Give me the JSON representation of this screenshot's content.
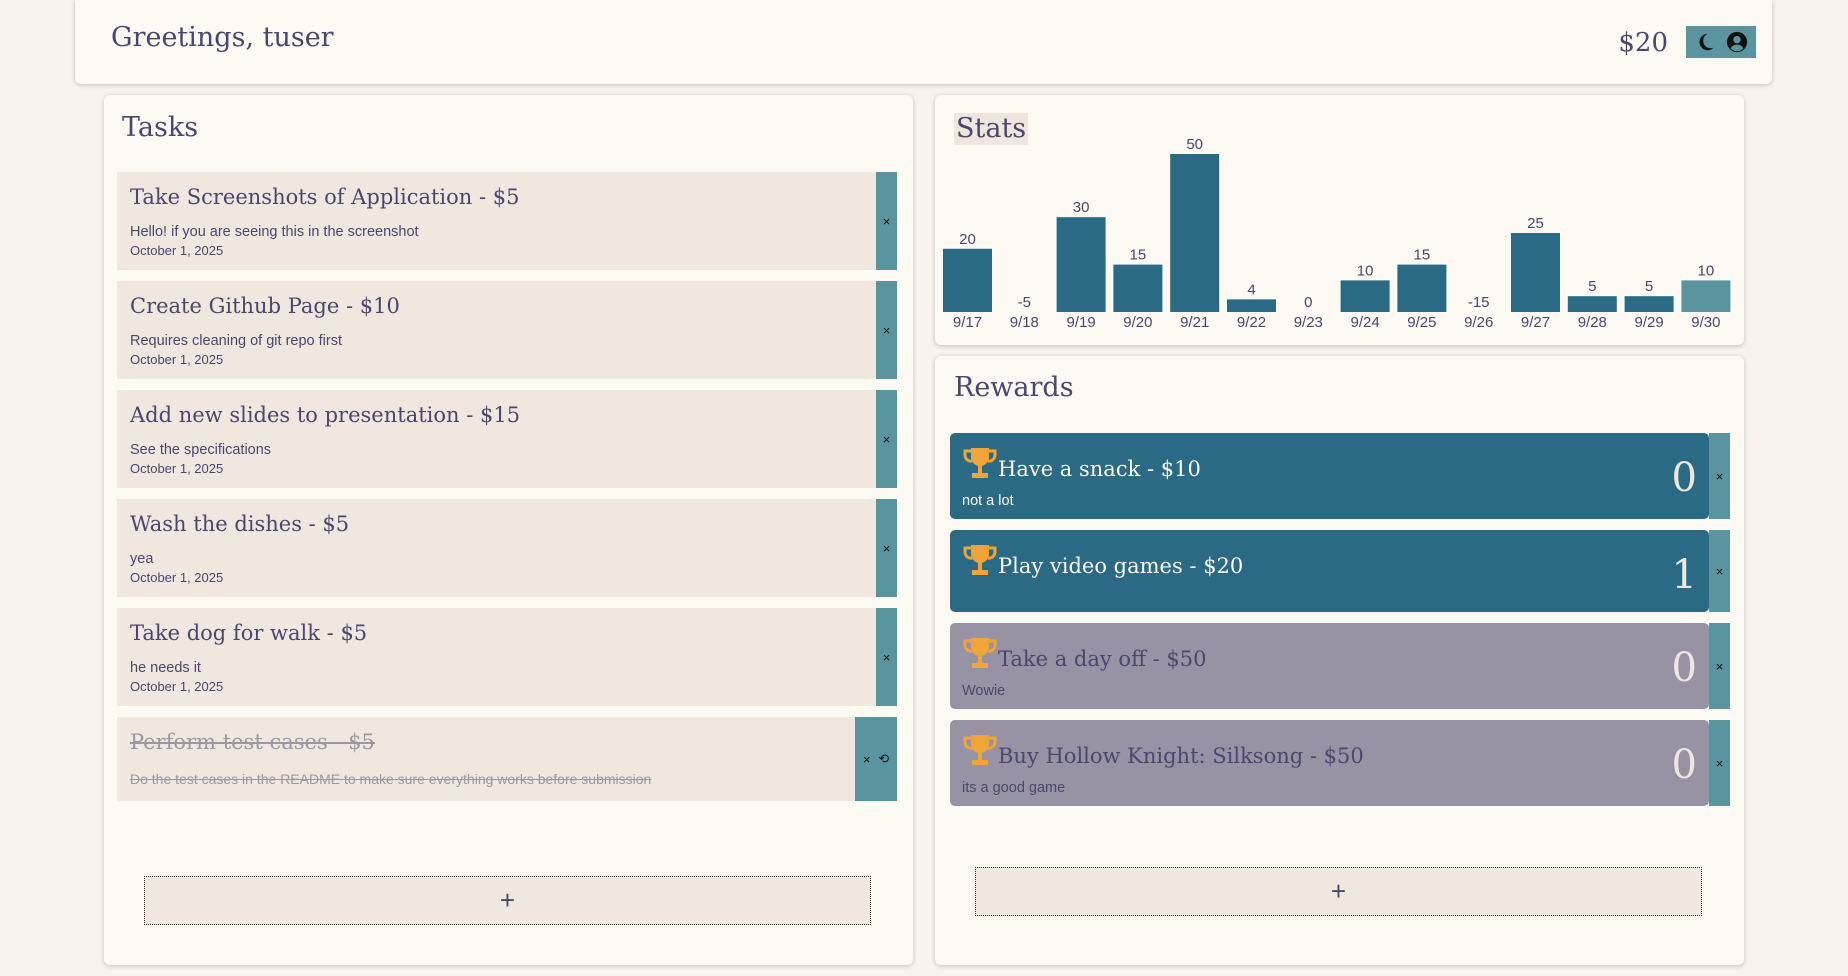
{
  "header": {
    "greeting": "Greetings, tuser",
    "balance": "$20",
    "icons": [
      "moon-icon",
      "user-circle-icon"
    ]
  },
  "tasks": {
    "title": "Tasks",
    "items": [
      {
        "title": "Take Screenshots of Application - $5",
        "desc": "Hello! if you are seeing this in the screenshot",
        "date": "October 1, 2025"
      },
      {
        "title": "Create Github Page - $10",
        "desc": "Requires cleaning of git repo first",
        "date": "October 1, 2025"
      },
      {
        "title": "Add new slides to presentation - $15",
        "desc": "See the specifications",
        "date": "October 1, 2025"
      },
      {
        "title": "Wash the dishes - $5",
        "desc": "yea",
        "date": "October 1, 2025"
      },
      {
        "title": "Take dog for walk - $5",
        "desc": "he needs it",
        "date": "October 1, 2025"
      }
    ],
    "completed": {
      "title": "Perform test cases - $5",
      "desc": "Do the test cases in the README to make sure everything works before submission"
    },
    "delete_glyph": "×",
    "restore_glyph": "⟲",
    "add_label": "+"
  },
  "stats": {
    "title": "Stats",
    "chart_data": {
      "type": "bar",
      "categories": [
        "9/17",
        "9/18",
        "9/19",
        "9/20",
        "9/21",
        "9/22",
        "9/23",
        "9/24",
        "9/25",
        "9/26",
        "9/27",
        "9/28",
        "9/29",
        "9/30"
      ],
      "values": [
        20,
        -5,
        30,
        15,
        50,
        4,
        0,
        10,
        15,
        -15,
        25,
        5,
        5,
        10
      ],
      "highlight_index": 13,
      "bar_color": "#2b6a84",
      "highlight_color": "#5a949e"
    }
  },
  "rewards": {
    "title": "Rewards",
    "items": [
      {
        "title": "Have a snack - $10",
        "desc": "not a lot",
        "count": "0",
        "state": "active"
      },
      {
        "title": "Play video games - $20",
        "desc": "",
        "count": "1",
        "state": "active"
      },
      {
        "title": "Take a day off - $50",
        "desc": "Wowie",
        "count": "0",
        "state": "inactive"
      },
      {
        "title": "Buy Hollow Knight: Silksong - $50",
        "desc": "its a good game",
        "count": "0",
        "state": "inactive"
      }
    ],
    "delete_glyph": "×",
    "add_label": "+",
    "trophy_color": "#f0a43a"
  },
  "colors": {
    "background": "#f8f3ec",
    "card": "#fdf9f3",
    "item": "#f0e8df",
    "accent": "#5a949e",
    "primary": "#2b6a84",
    "muted": "#9893a4",
    "text": "#4b4670"
  }
}
